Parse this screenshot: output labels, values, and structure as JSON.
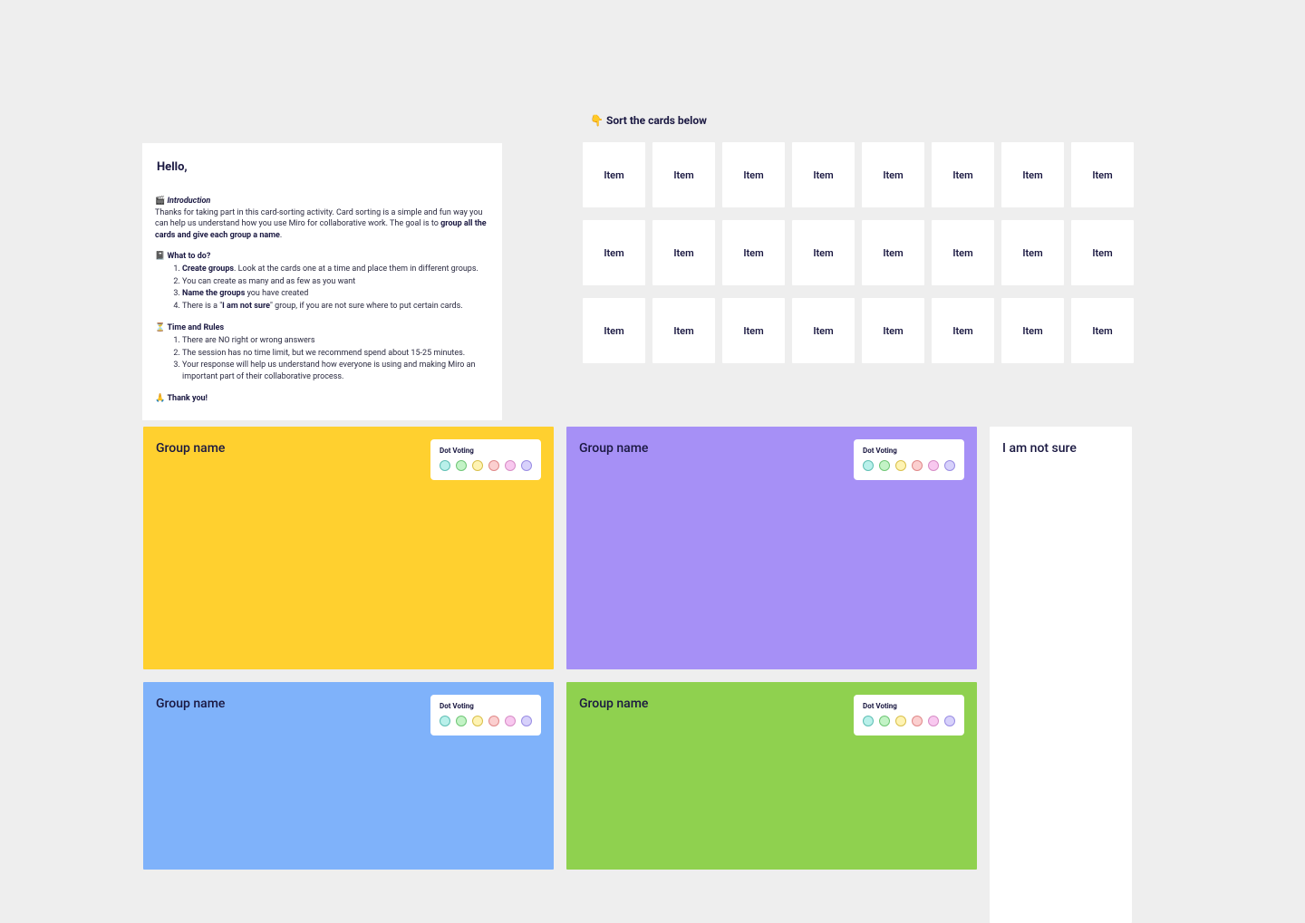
{
  "intro": {
    "hello": "Hello,",
    "introduction": {
      "icon": "🎬",
      "heading": "Introduction",
      "body_pre": "Thanks for taking part in this card-sorting activity. Card sorting is a simple and fun way you can help us understand how you use Miro for collaborative work. The goal is to ",
      "body_bold": "group all the cards and give each group a name",
      "body_post": "."
    },
    "what": {
      "icon": "📓",
      "heading": "What to do?",
      "items": [
        {
          "pre": "",
          "bold": "Create groups",
          "post": ". Look at the cards one at a time and place them in different groups."
        },
        {
          "pre": "You can create as many and as few as you want",
          "bold": "",
          "post": ""
        },
        {
          "pre": "",
          "bold": "Name the groups",
          "post": " you have created"
        },
        {
          "pre": "There is a \"",
          "bold": "I am not sure",
          "post": "\" group, if you are not sure where to put certain cards."
        }
      ]
    },
    "rules": {
      "icon": "⏳",
      "heading": "Time and Rules",
      "items": [
        "There are NO right or wrong answers",
        "The session has no time limit, but we recommend spend about 15-25 minutes.",
        "Your response will help us understand how everyone is using and making Miro an important part of their collaborative process."
      ]
    },
    "thanks": {
      "icon": "🙏",
      "text": "Thank you!"
    }
  },
  "sort_label": {
    "icon": "👇",
    "text": "Sort the cards below"
  },
  "cards": [
    "Item",
    "Item",
    "Item",
    "Item",
    "Item",
    "Item",
    "Item",
    "Item",
    "Item",
    "Item",
    "Item",
    "Item",
    "Item",
    "Item",
    "Item",
    "Item",
    "Item",
    "Item",
    "Item",
    "Item",
    "Item",
    "Item",
    "Item",
    "Item"
  ],
  "groups_row1": [
    {
      "title": "Group name",
      "color": "#ffd02f"
    },
    {
      "title": "Group name",
      "color": "#a690f6"
    }
  ],
  "groups_row2": [
    {
      "title": "Group name",
      "color": "#7fb2fa"
    },
    {
      "title": "Group name",
      "color": "#8fd14f"
    }
  ],
  "not_sure_title": "I am not sure",
  "dot_voting": {
    "label": "Dot Voting",
    "dots": [
      {
        "fill": "#b9f0ea",
        "stroke": "#5fbfb4"
      },
      {
        "fill": "#c3f3c6",
        "stroke": "#6fc676"
      },
      {
        "fill": "#fef3b3",
        "stroke": "#d9c04b"
      },
      {
        "fill": "#fbcfcf",
        "stroke": "#e08888"
      },
      {
        "fill": "#f8c8ef",
        "stroke": "#d78dc6"
      },
      {
        "fill": "#d7d1fb",
        "stroke": "#9a8de3"
      }
    ]
  }
}
